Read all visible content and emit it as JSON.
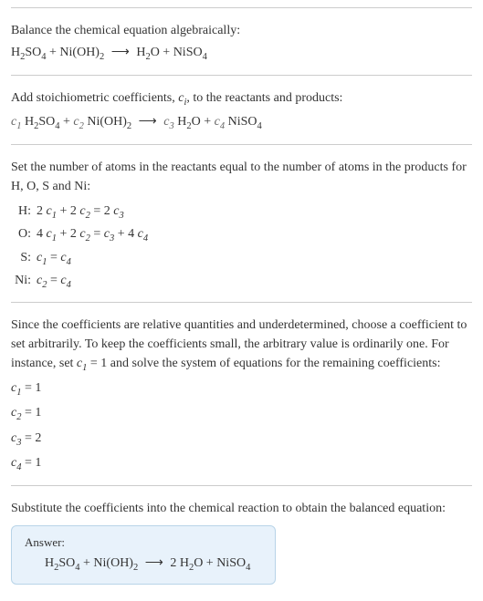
{
  "s1": {
    "intro": "Balance the chemical equation algebraically:",
    "eq_lhs1": "H",
    "eq_lhs1s": "2",
    "eq_lhs2": "SO",
    "eq_lhs2s": "4",
    "plus1": " + Ni(OH)",
    "eq_lhs3s": "2",
    "arrow": "⟶",
    "eq_rhs1": "H",
    "eq_rhs1s": "2",
    "eq_rhs2": "O + NiSO",
    "eq_rhs2s": "4"
  },
  "s2": {
    "intro1": "Add stoichiometric coefficients, ",
    "ci": "c",
    "cis": "i",
    "intro2": ", to the reactants and products:",
    "c1": "c",
    "c1s": "1",
    "sp1": " H",
    "sp1s": "2",
    "sp1b": "SO",
    "sp1bs": "4",
    "plus1": " + ",
    "c2": "c",
    "c2s": "2",
    "sp2": " Ni(OH)",
    "sp2s": "2",
    "arrow": "⟶",
    "c3": "c",
    "c3s": "3",
    "sp3": " H",
    "sp3s": "2",
    "sp3b": "O + ",
    "c4": "c",
    "c4s": "4",
    "sp4": " NiSO",
    "sp4s": "4"
  },
  "s3": {
    "intro": "Set the number of atoms in the reactants equal to the number of atoms in the products for H, O, S and Ni:",
    "rows": {
      "h_el": "H:",
      "h_eq_a": "2 ",
      "h_c1": "c",
      "h_c1s": "1",
      "h_eq_b": " + 2 ",
      "h_c2": "c",
      "h_c2s": "2",
      "h_eq_c": " = 2 ",
      "h_c3": "c",
      "h_c3s": "3",
      "o_el": "O:",
      "o_eq_a": "4 ",
      "o_c1": "c",
      "o_c1s": "1",
      "o_eq_b": " + 2 ",
      "o_c2": "c",
      "o_c2s": "2",
      "o_eq_c": " = ",
      "o_c3": "c",
      "o_c3s": "3",
      "o_eq_d": " + 4 ",
      "o_c4": "c",
      "o_c4s": "4",
      "s_el": "S:",
      "s_c1": "c",
      "s_c1s": "1",
      "s_eq_a": " = ",
      "s_c4": "c",
      "s_c4s": "4",
      "ni_el": "Ni:",
      "ni_c2": "c",
      "ni_c2s": "2",
      "ni_eq_a": " = ",
      "ni_c4": "c",
      "ni_c4s": "4"
    }
  },
  "s4": {
    "intro_a": "Since the coefficients are relative quantities and underdetermined, choose a coefficient to set arbitrarily. To keep the coefficients small, the arbitrary value is ordinarily one. For instance, set ",
    "cset": "c",
    "csets": "1",
    "intro_b": " = 1 and solve the system of equations for the remaining coefficients:",
    "r1a": "c",
    "r1s": "1",
    "r1b": " = 1",
    "r2a": "c",
    "r2s": "2",
    "r2b": " = 1",
    "r3a": "c",
    "r3s": "3",
    "r3b": " = 2",
    "r4a": "c",
    "r4s": "4",
    "r4b": " = 1"
  },
  "s5": {
    "intro": "Substitute the coefficients into the chemical reaction to obtain the balanced equation:",
    "answer_label": "Answer:",
    "eq_a": "H",
    "eq_as": "2",
    "eq_b": "SO",
    "eq_bs": "4",
    "plus1": " + Ni(OH)",
    "eq_cs": "2",
    "arrow": "⟶",
    "rhs_a": "2 H",
    "rhs_as": "2",
    "rhs_b": "O + NiSO",
    "rhs_bs": "4"
  }
}
